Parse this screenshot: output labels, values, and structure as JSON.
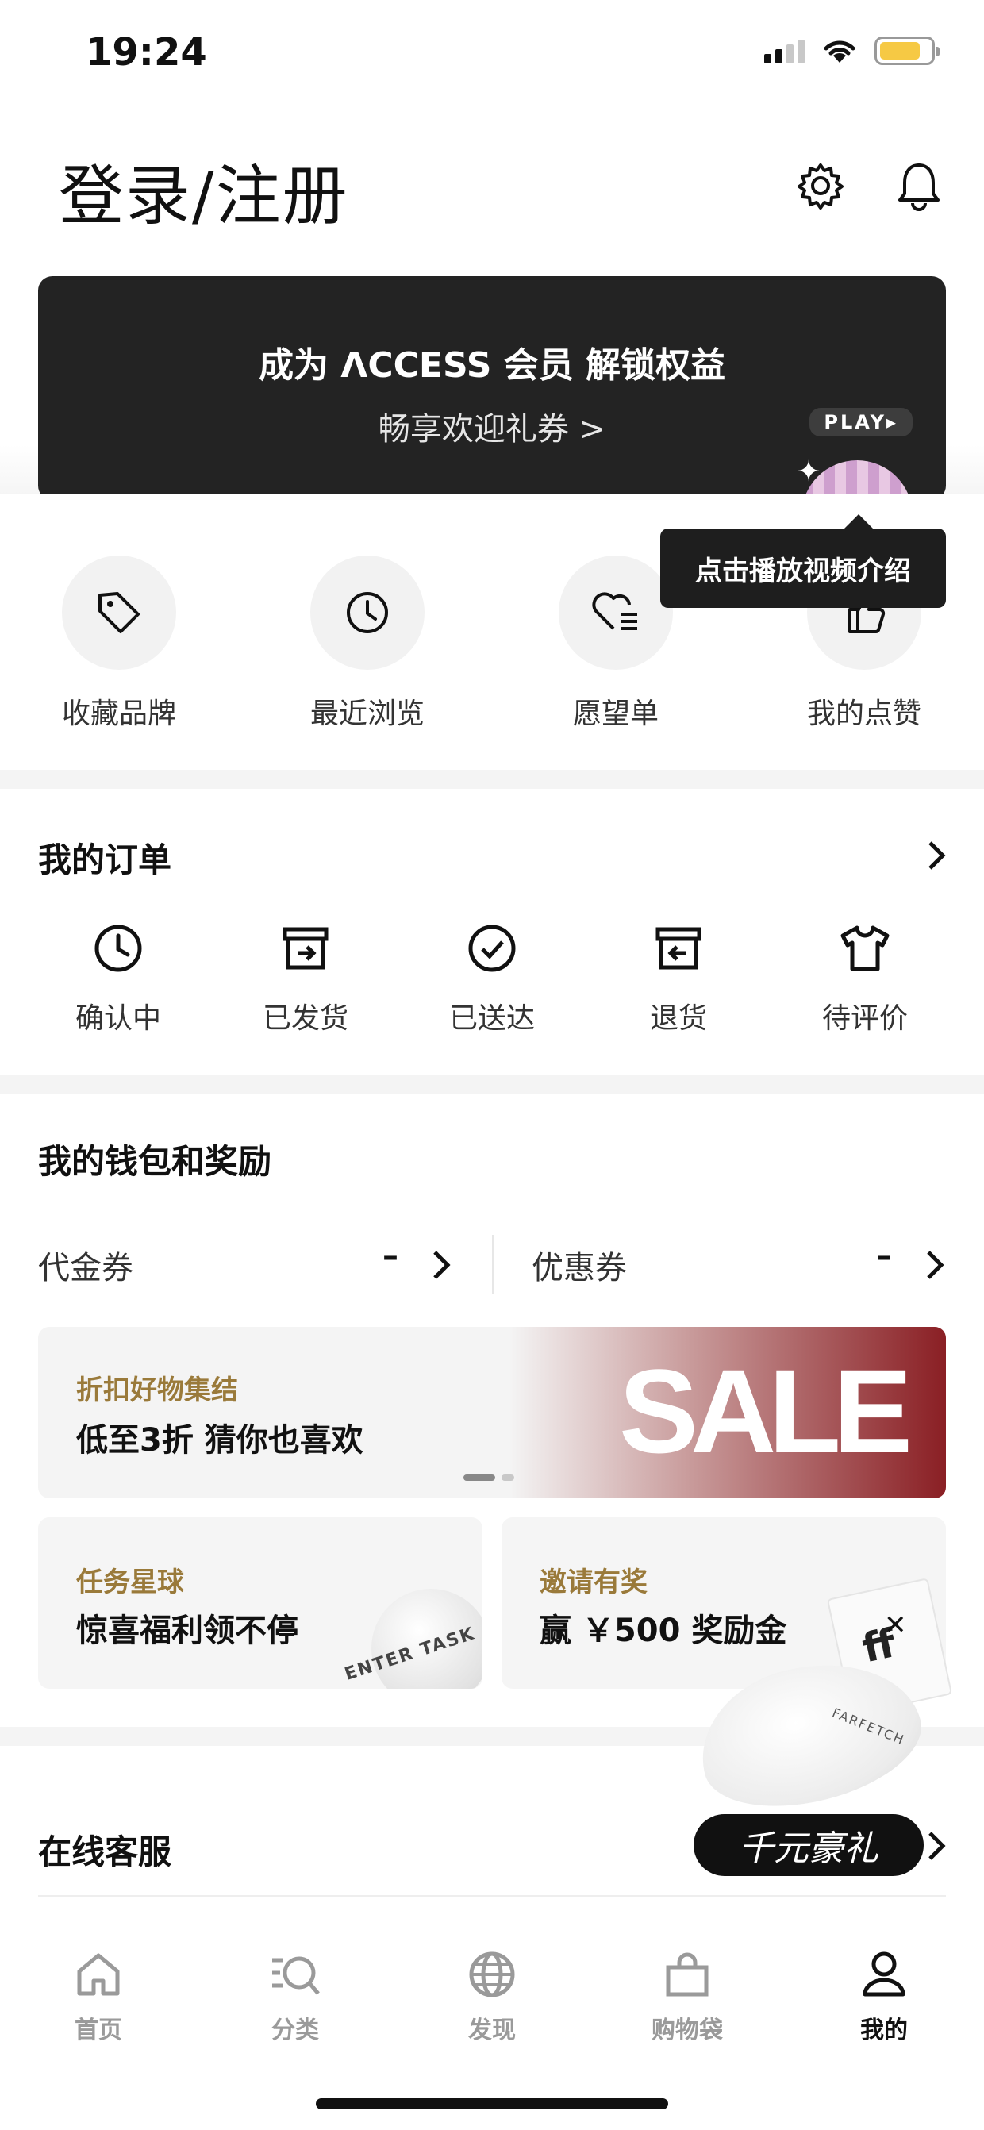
{
  "status_bar": {
    "time": "19:24"
  },
  "header": {
    "title": "登录/注册",
    "settings_icon": "gear-icon",
    "notifications_icon": "bell-icon"
  },
  "banner": {
    "title": "成为 ΛCCESS 会员 解锁权益",
    "subtitle": "畅享欢迎礼券 >",
    "play_badge": "PLAY▸"
  },
  "tooltip": {
    "text": "点击播放视频介绍"
  },
  "shortcuts": [
    {
      "label": "收藏品牌",
      "icon": "tag-icon"
    },
    {
      "label": "最近浏览",
      "icon": "clock-icon"
    },
    {
      "label": "愿望单",
      "icon": "heart-list-icon"
    },
    {
      "label": "我的点赞",
      "icon": "thumb-up-icon"
    }
  ],
  "orders": {
    "title": "我的订单",
    "items": [
      {
        "label": "确认中",
        "icon": "clock-icon"
      },
      {
        "label": "已发货",
        "icon": "box-out-icon"
      },
      {
        "label": "已送达",
        "icon": "check-circle-icon"
      },
      {
        "label": "退货",
        "icon": "box-return-icon"
      },
      {
        "label": "待评价",
        "icon": "tshirt-icon"
      }
    ]
  },
  "wallet": {
    "title": "我的钱包和奖励",
    "voucher_label": "代金券",
    "voucher_value": "–",
    "coupon_label": "优惠券",
    "coupon_value": "–"
  },
  "promo": {
    "kicker": "折扣好物集结",
    "headline": "低至3折 猜你也喜欢",
    "sale_text": "SALE"
  },
  "mini_cards": [
    {
      "kicker": "任务星球",
      "headline": "惊喜福利领不停",
      "decor_text": "ENTER TASK"
    },
    {
      "kicker": "邀请有奖",
      "headline": "赢 ￥500 奖励金"
    }
  ],
  "float_promo": {
    "label": "千元豪礼",
    "mask_text": "FARFETCH"
  },
  "service": {
    "title": "在线客服"
  },
  "tabs": [
    {
      "label": "首页",
      "icon": "home-icon"
    },
    {
      "label": "分类",
      "icon": "category-search-icon"
    },
    {
      "label": "发现",
      "icon": "globe-icon"
    },
    {
      "label": "购物袋",
      "icon": "bag-icon"
    },
    {
      "label": "我的",
      "icon": "person-icon"
    }
  ],
  "colors": {
    "accent_gold": "#9a7a3a",
    "dark": "#232323",
    "battery": "#f6c944"
  }
}
